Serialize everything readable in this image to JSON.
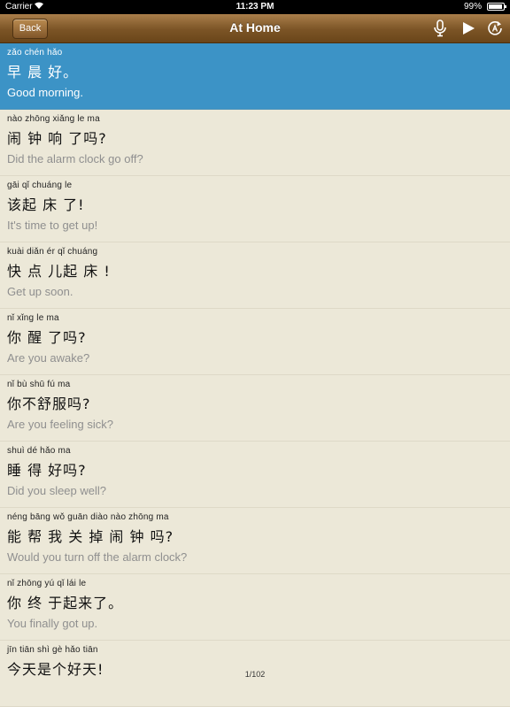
{
  "status_bar": {
    "carrier": "Carrier",
    "time": "11:23 PM",
    "battery": "99%"
  },
  "nav": {
    "back_label": "Back",
    "title": "At Home",
    "icons": [
      "mic-icon",
      "play-icon",
      "repeat-icon"
    ],
    "bar_color": "#7b5426"
  },
  "accent_color": "#3c93c6",
  "phrases": [
    {
      "pinyin": "zǎo chén hǎo",
      "hanzi": "早 晨 好。",
      "english": "Good morning."
    },
    {
      "pinyin": "nào zhōng xiǎng le ma",
      "hanzi": "闹 钟 响 了吗?",
      "english": "Did the alarm clock go off?"
    },
    {
      "pinyin": "gāi qǐ chuáng le",
      "hanzi": "该起 床 了!",
      "english": "It's time to get up!"
    },
    {
      "pinyin": "kuài diǎn ér qǐ chuáng",
      "hanzi": "快 点 儿起 床 !",
      "english": "Get up soon."
    },
    {
      "pinyin": "nǐ xǐng le ma",
      "hanzi": "你 醒 了吗?",
      "english": "Are you awake?"
    },
    {
      "pinyin": "nǐ bù shū fú ma",
      "hanzi": "你不舒服吗?",
      "english": "Are you feeling sick?"
    },
    {
      "pinyin": "shuì dé hǎo ma",
      "hanzi": "睡 得 好吗?",
      "english": "Did you sleep well?"
    },
    {
      "pinyin": "néng bāng wǒ guān diào nào zhōng ma",
      "hanzi": "能 帮 我 关 掉 闹 钟 吗?",
      "english": "Would you turn off the alarm clock?"
    },
    {
      "pinyin": "nǐ zhōng yú qǐ lái le",
      "hanzi": "你 终 于起来了。",
      "english": "You finally got up."
    },
    {
      "pinyin": "jīn tiān shì gè hǎo tiān",
      "hanzi": "今天是个好天!",
      "english": ""
    }
  ],
  "page_indicator": "1/102"
}
